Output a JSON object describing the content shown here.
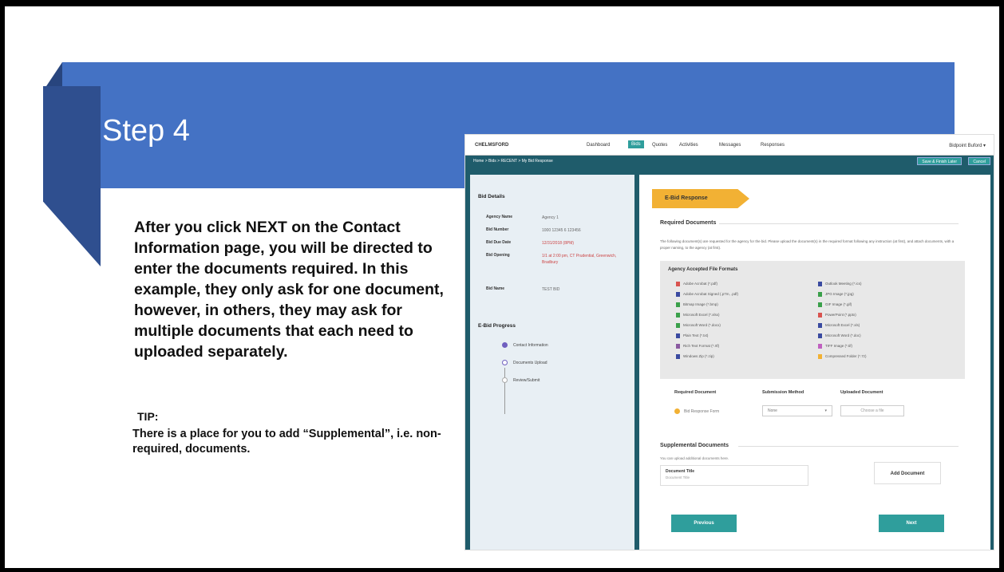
{
  "slide": {
    "title": "Step 4",
    "body": "After you click NEXT on the Contact Information page, you will be directed to enter the documents required. In this example, they only ask for one document, however, in others, they may ask for multiple documents that each need to uploaded separately.",
    "tip_title": "TIP:",
    "tip_text": "There is a place for you to add “Supplemental”, i.e. non-required, documents."
  },
  "app": {
    "brand": "CHELMSFORD",
    "nav": [
      "Dashboard",
      "Bids",
      "Quotes",
      "Activities",
      "Messages",
      "Responses"
    ],
    "active_nav": "Bids",
    "user": "Bidpoint Buford ▾",
    "breadcrumb": "Home > Bids > RECENT > My Bid Response",
    "save_button": "Save & Finish Later",
    "cancel_button": "Cancel",
    "bid_details": {
      "title": "Bid Details",
      "rows": [
        {
          "label": "Agency Name",
          "value": "Agency 1"
        },
        {
          "label": "Bid Number",
          "value": "1000 12345 6 123456"
        },
        {
          "label": "Bid Due Date",
          "value": "12/31/2018 (8PM)"
        },
        {
          "label": "Bid Opening",
          "value": "1/1 at 2:00 pm, CT Prudential, Greenwich, Bradbury"
        },
        {
          "label": "Bid Name",
          "value": "TEST BID"
        }
      ]
    },
    "progress": {
      "title": "E-Bid Progress",
      "steps": [
        "Contact Information",
        "Documents Upload",
        "Review/Submit"
      ]
    },
    "main": {
      "ribbon": "E-Bid Response",
      "required_title": "Required Documents",
      "instructions": "The following document(s) are requested for the agency for the bid. Please upload the document(s) in the required format following any instruction (at first), and attach documents, with a proper naming, to the agency (at first).",
      "formats_title": "Agency Accepted File Formats",
      "formats_left": [
        "Adobe Acrobat (*.pdf)",
        "Adobe Acrobat Signed (.p7m, .pdf)",
        "Bitmap Image (*.bmp)",
        "Microsoft Excel (*.xlsx)",
        "Microsoft Word (*.docx)",
        "Plain Text (*.txt)",
        "Rich Text Format (*.rtf)",
        "Windows Zip (*.zip)"
      ],
      "formats_right": [
        "Outlook Meeting (*.ics)",
        "JPG Image (*.jpg)",
        "GIF Image (*.gif)",
        "PowerPoint (*.pptx)",
        "Microsoft Excel (*.xls)",
        "Microsoft Word (*.doc)",
        "TIFF Image (*.tif)",
        "Compressed Folder (*.7z)"
      ],
      "col_required": "Required Document",
      "col_submission": "Submission Method",
      "col_uploaded": "Uploaded Document",
      "required_doc_name": "Bid Response Form",
      "submission_value": "None",
      "upload_placeholder": "Choose a file",
      "supplemental_title": "Supplemental Documents",
      "supplemental_note": "You can upload additional documents here.",
      "doc_title_label": "Document Title",
      "doc_title_placeholder": "Document Title",
      "add_document": "Add Document",
      "previous": "Previous",
      "next": "Next"
    }
  }
}
